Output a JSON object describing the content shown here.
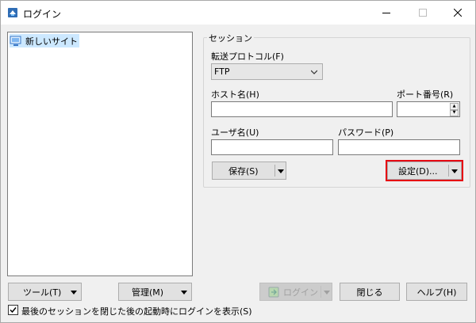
{
  "window": {
    "title": "ログイン",
    "icon": "winscp-app-icon"
  },
  "site_tree": {
    "items": [
      {
        "label": "新しいサイト",
        "icon": "computer-icon"
      }
    ]
  },
  "session": {
    "group_label": "セッション",
    "protocol_label": "転送プロトコル(F)",
    "protocol_value": "FTP",
    "host_label": "ホスト名(H)",
    "host_value": "",
    "port_label": "ポート番号(R)",
    "port_value": "",
    "user_label": "ユーザ名(U)",
    "user_value": "",
    "password_label": "パスワード(P)",
    "password_value": "",
    "save_label": "保存(S)",
    "advanced_label": "設定(D)..."
  },
  "footer": {
    "tools_label": "ツール(T)",
    "manage_label": "管理(M)",
    "login_label": "ログイン",
    "close_label": "閉じる",
    "help_label": "ヘルプ(H)",
    "checkbox_label": "最後のセッションを閉じた後の起動時にログインを表示(S)",
    "checkbox_checked": true
  },
  "colors": {
    "highlight": "#e60012",
    "selection": "#cce8ff"
  }
}
